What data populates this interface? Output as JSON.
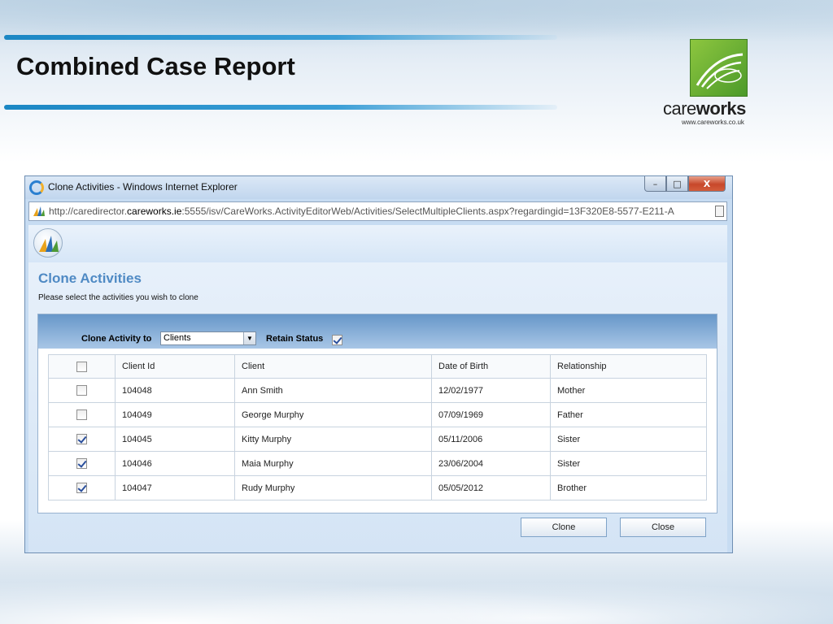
{
  "slide": {
    "title": "Combined Case Report",
    "logo": {
      "brand_light": "care",
      "brand_bold": "works",
      "url": "www.careworks.co.uk",
      "color": "#6fb232"
    }
  },
  "window": {
    "title": "Clone Activities - Windows Internet Explorer",
    "controls": {
      "minimize": "–",
      "maximize": "□",
      "close": "X"
    },
    "address": {
      "prefix": "http://caredirector.",
      "domain": "careworks.ie",
      "rest": ":5555/isv/CareWorks.ActivityEditorWeb/Activities/SelectMultipleClients.aspx?regardingid=13F320E8-5577-E211-A"
    }
  },
  "page": {
    "heading": "Clone Activities",
    "subtitle": "Please select the activities you wish to clone",
    "filter": {
      "clone_label": "Clone Activity to",
      "selected": "Clients",
      "retain_label": "Retain Status",
      "retain_checked": true
    },
    "table": {
      "headers": [
        "Client Id",
        "Client",
        "Date of Birth",
        "Relationship"
      ],
      "select_all_checked": false,
      "rows": [
        {
          "checked": false,
          "id": "104048",
          "client": "Ann Smith",
          "dob": "12/02/1977",
          "relationship": "Mother"
        },
        {
          "checked": false,
          "id": "104049",
          "client": "George Murphy",
          "dob": "07/09/1969",
          "relationship": "Father"
        },
        {
          "checked": true,
          "id": "104045",
          "client": "Kitty Murphy",
          "dob": "05/11/2006",
          "relationship": "Sister"
        },
        {
          "checked": true,
          "id": "104046",
          "client": "Maia Murphy",
          "dob": "23/06/2004",
          "relationship": "Sister"
        },
        {
          "checked": true,
          "id": "104047",
          "client": "Rudy Murphy",
          "dob": "05/05/2012",
          "relationship": "Brother"
        }
      ]
    },
    "buttons": {
      "clone": "Clone",
      "close": "Close"
    }
  }
}
